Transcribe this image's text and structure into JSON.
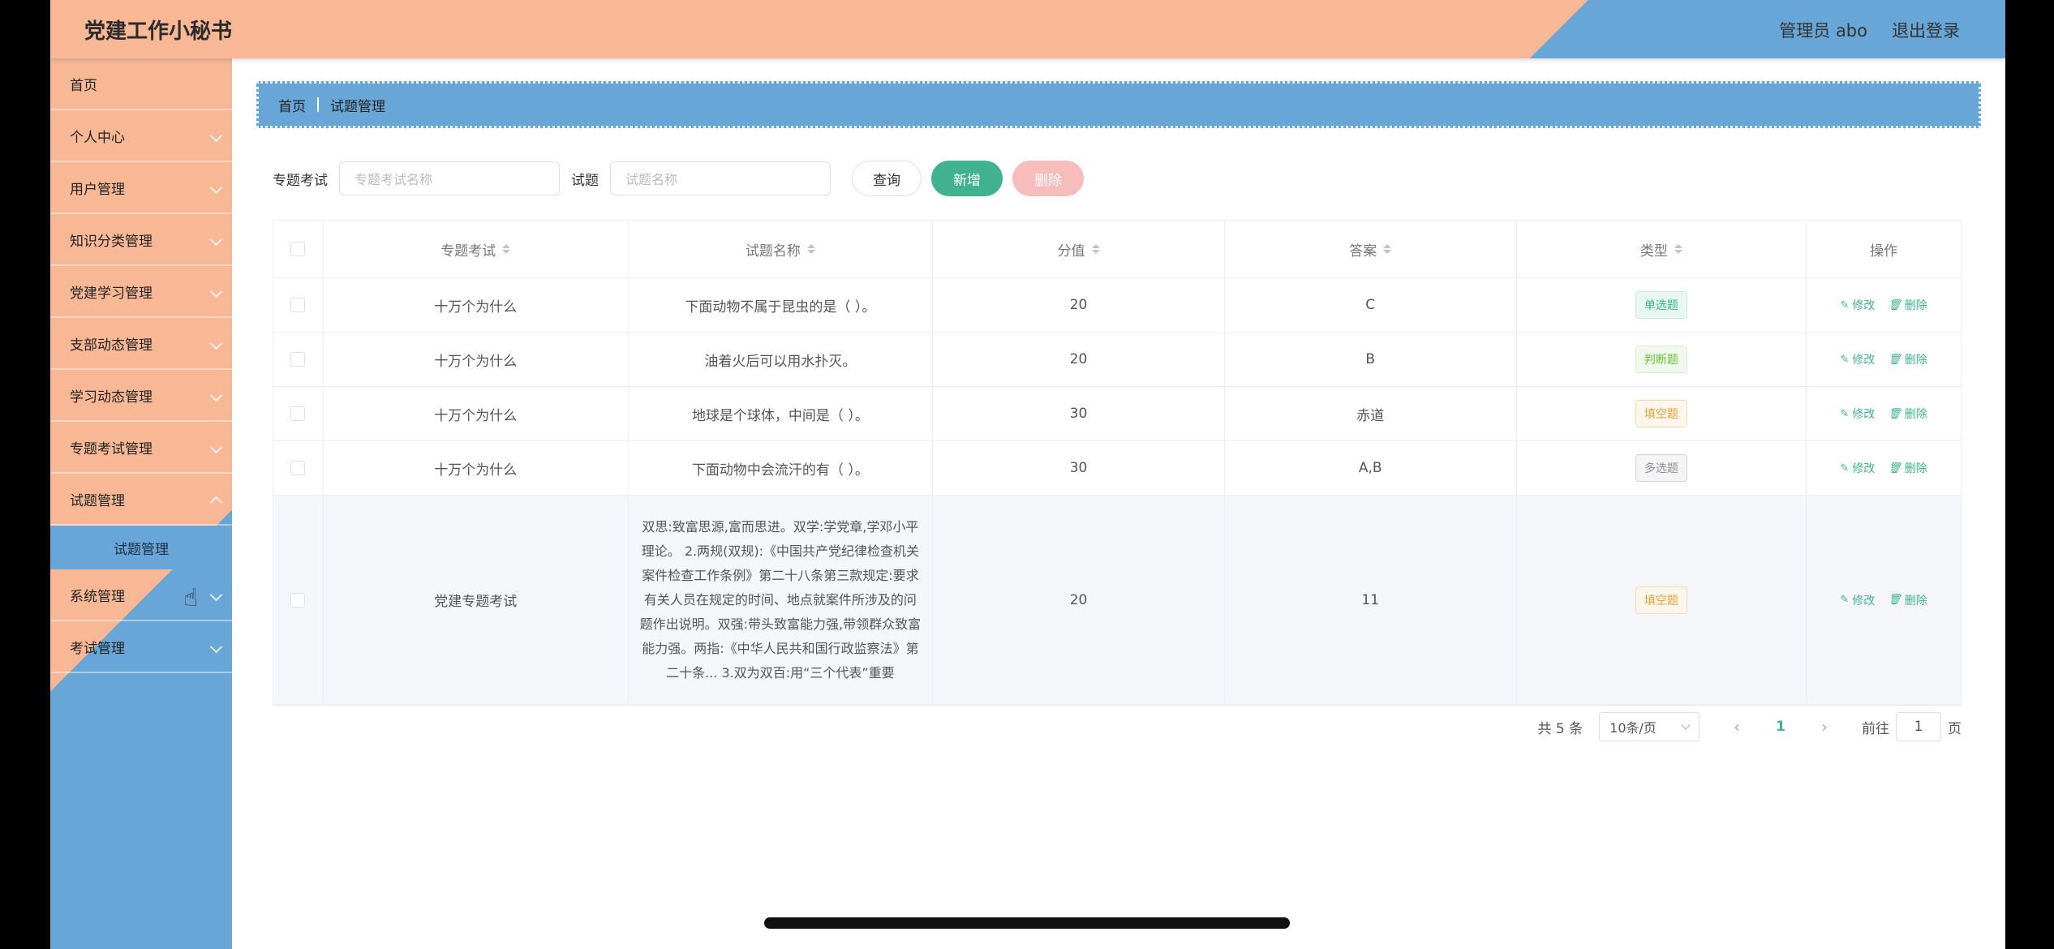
{
  "header": {
    "title": "党建工作小秘书",
    "user": "管理员 abo",
    "logout": "退出登录"
  },
  "sidebar": {
    "items": [
      {
        "label": "首页"
      },
      {
        "label": "个人中心"
      },
      {
        "label": "用户管理"
      },
      {
        "label": "知识分类管理"
      },
      {
        "label": "党建学习管理"
      },
      {
        "label": "支部动态管理"
      },
      {
        "label": "学习动态管理"
      },
      {
        "label": "专题考试管理"
      },
      {
        "label": "试题管理"
      },
      {
        "label": "系统管理"
      },
      {
        "label": "考试管理"
      }
    ],
    "active_sub": "试题管理"
  },
  "breadcrumb": {
    "home": "首页",
    "current": "试题管理"
  },
  "filters": {
    "exam_label": "专题考试",
    "exam_placeholder": "专题考试名称",
    "question_label": "试题",
    "question_placeholder": "试题名称",
    "query": "查询",
    "add": "新增",
    "delete": "删除"
  },
  "table": {
    "headers": [
      "专题考试",
      "试题名称",
      "分值",
      "答案",
      "类型",
      "操作"
    ],
    "rows": [
      {
        "exam": "十万个为什么",
        "question": "下面动物不属于昆虫的是（ ）。",
        "score": "20",
        "answer": "C",
        "type": "单选题"
      },
      {
        "exam": "十万个为什么",
        "question": "油着火后可以用水扑灭。",
        "score": "20",
        "answer": "B",
        "type": "判断题"
      },
      {
        "exam": "十万个为什么",
        "question": "地球是个球体，中间是（ ）。",
        "score": "30",
        "answer": "赤道",
        "type": "填空题"
      },
      {
        "exam": "十万个为什么",
        "question": "下面动物中会流汗的有（ ）。",
        "score": "30",
        "answer": "A,B",
        "type": "多选题"
      },
      {
        "exam": "党建专题考试",
        "question": "双思:致富思源,富而思进。双学:学党章,学邓小平理论。 2.两规(双规):《中国共产党纪律检查机关案件检查工作条例》第二十八条第三款规定:要求有关人员在规定的时间、地点就案件所涉及的问题作出说明。双强:带头致富能力强,带领群众致富能力强。两指:《中华人民共和国行政监察法》第二十条... 3.双为双百:用“三个代表”重要",
        "score": "20",
        "answer": "11",
        "type": "填空题"
      }
    ],
    "edit": "修改",
    "remove": "删除"
  },
  "pagination": {
    "total": "共 5 条",
    "page_size": "10条/页",
    "current": "1",
    "goto": "前往",
    "goto_value": "1",
    "page_unit": "页"
  },
  "colors": {
    "peach": "#f8b896",
    "blue": "#67a6d6",
    "accent": "#40b28e",
    "danger": "#f7bcbc"
  }
}
